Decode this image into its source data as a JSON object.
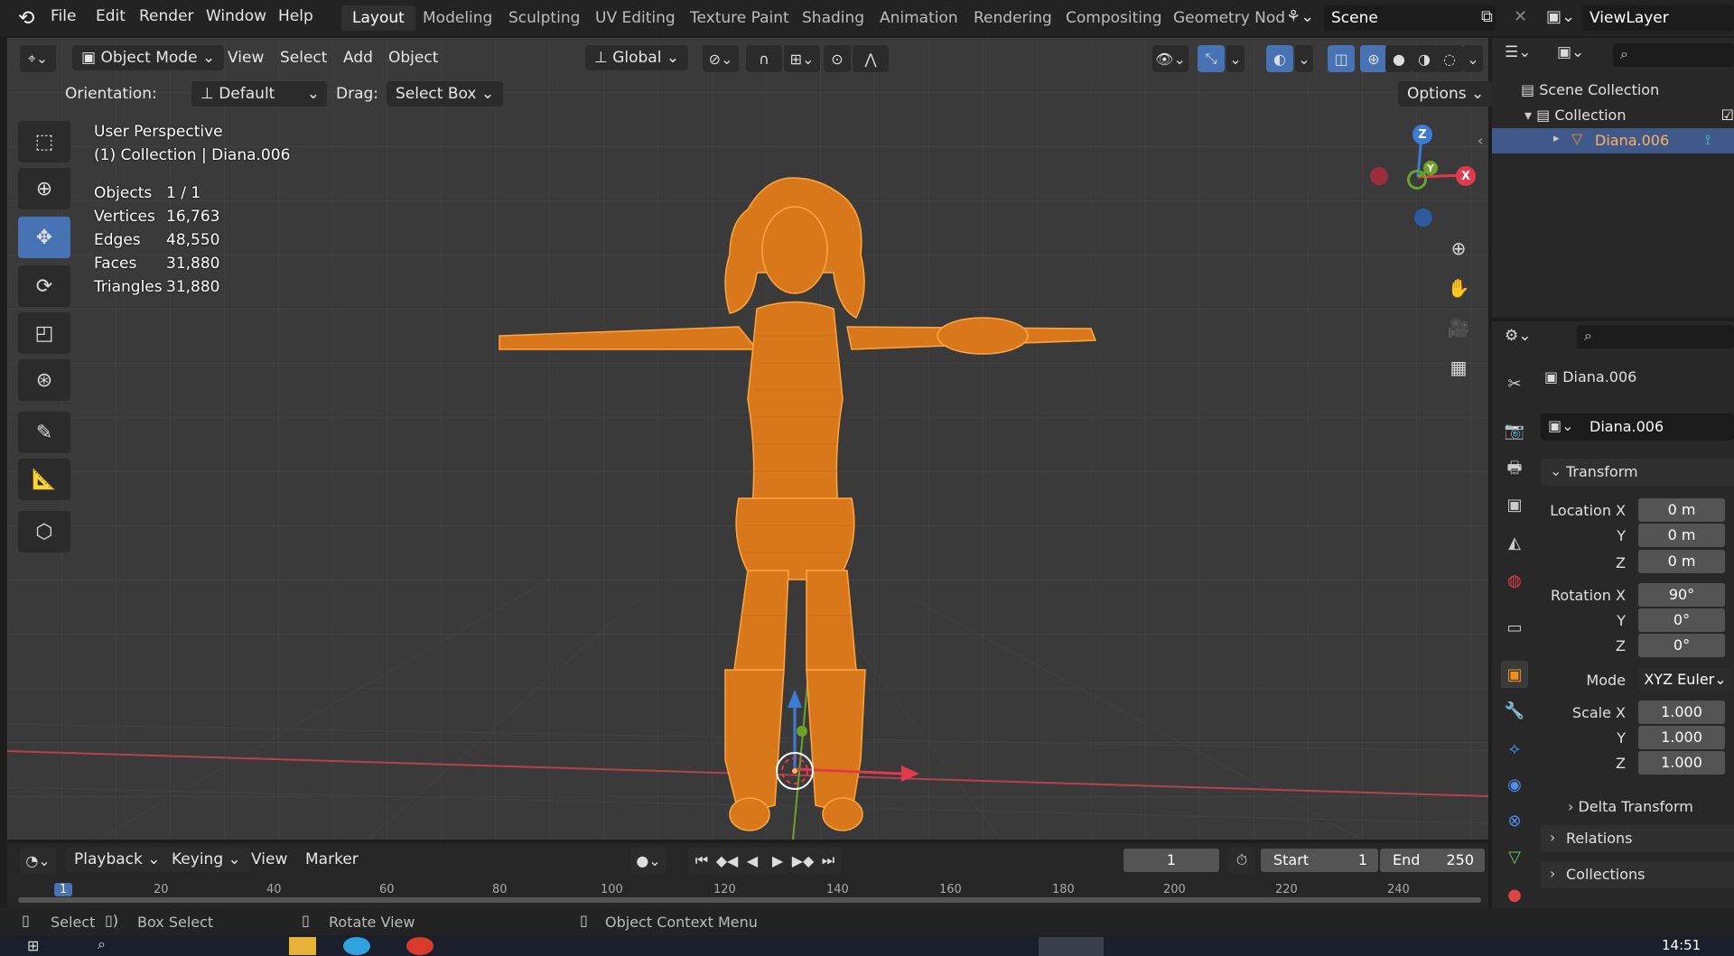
{
  "menu": {
    "items": [
      "File",
      "Edit",
      "Render",
      "Window",
      "Help"
    ]
  },
  "workspaces": [
    "Layout",
    "Modeling",
    "Sculpting",
    "UV Editing",
    "Texture Paint",
    "Shading",
    "Animation",
    "Rendering",
    "Compositing",
    "Geometry Nod"
  ],
  "scene": {
    "name": "Scene",
    "view_layer": "ViewLayer"
  },
  "viewport_header": {
    "mode": "Object Mode",
    "menus": [
      "View",
      "Select",
      "Add",
      "Object"
    ],
    "transform_orientation": "Global"
  },
  "tool_header": {
    "orientation_label": "Orientation:",
    "orientation_value": "Default",
    "drag_label": "Drag:",
    "drag_value": "Select Box",
    "options_label": "Options"
  },
  "overlay": {
    "perspective": "User Perspective",
    "context": "(1) Collection | Diana.006",
    "stats": [
      {
        "label": "Objects",
        "value": "1 / 1"
      },
      {
        "label": "Vertices",
        "value": "16,763"
      },
      {
        "label": "Edges",
        "value": "48,550"
      },
      {
        "label": "Faces",
        "value": "31,880"
      },
      {
        "label": "Triangles",
        "value": "31,880"
      }
    ]
  },
  "gizmo": {
    "z": "Z",
    "y": "Y",
    "x": "X"
  },
  "outliner": {
    "scene_collection": "Scene Collection",
    "collection": "Collection",
    "object": "Diana.006"
  },
  "properties": {
    "object_name": "Diana.006",
    "object_datablock": "Diana.006",
    "transform_header": "Transform",
    "location": {
      "label": "Location X",
      "x": "0 m",
      "y": "0 m",
      "z": "0 m"
    },
    "rotation": {
      "label": "Rotation X",
      "x": "90°",
      "y": "0°",
      "z": "0°"
    },
    "mode_label": "Mode",
    "mode_value": "XYZ Euler",
    "scale": {
      "label": "Scale X",
      "x": "1.000",
      "y": "1.000",
      "z": "1.000"
    },
    "axis_y": "Y",
    "axis_z": "Z",
    "delta_transform": "Delta Transform",
    "relations": "Relations",
    "collections": "Collections"
  },
  "timeline": {
    "menus": [
      "Playback",
      "Keying",
      "View",
      "Marker"
    ],
    "current_frame": "1",
    "start_label": "Start",
    "start_value": "1",
    "end_label": "End",
    "end_value": "250",
    "ruler": [
      "1",
      "20",
      "40",
      "60",
      "80",
      "100",
      "120",
      "140",
      "160",
      "180",
      "200",
      "220",
      "240"
    ]
  },
  "statusbar": {
    "select": "Select",
    "box_select": "Box Select",
    "rotate_view": "Rotate View",
    "context_menu": "Object Context Menu"
  },
  "taskbar": {
    "time": "14:51"
  },
  "colors": {
    "accent": "#4772b3",
    "mesh": "#f0901e",
    "background": "#3a3a3a"
  }
}
